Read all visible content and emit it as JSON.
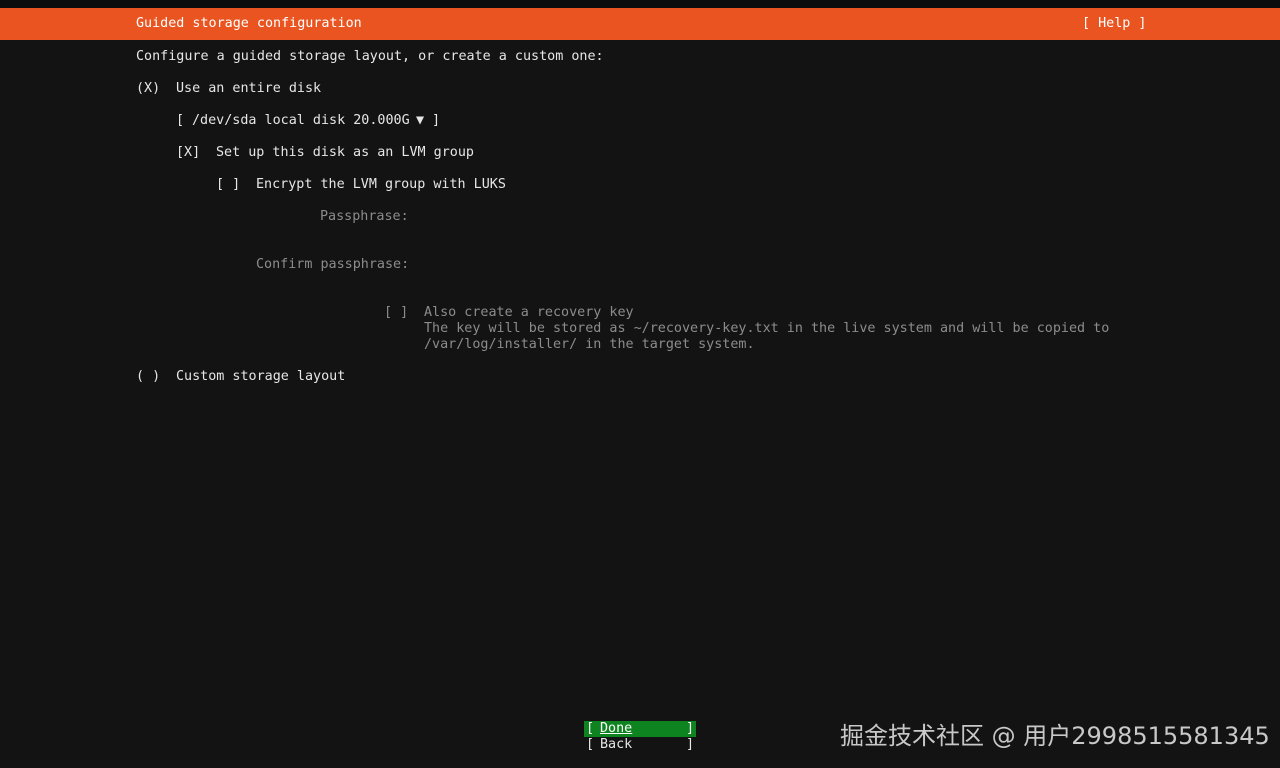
{
  "header": {
    "title": "Guided storage configuration",
    "help": "[ Help ]"
  },
  "intro": "Configure a guided storage layout, or create a custom one:",
  "option_entire_disk": {
    "marker": "(X)",
    "label": "Use an entire disk"
  },
  "disk_select": {
    "open_bracket": "[",
    "value": "/dev/sda local disk 20.000G",
    "arrow": "▼",
    "close_bracket": "]"
  },
  "lvm": {
    "marker": "[X]",
    "label": "Set up this disk as an LVM group"
  },
  "luks": {
    "marker": "[ ]",
    "label": "Encrypt the LVM group with LUKS"
  },
  "passphrase": {
    "label": "Passphrase:",
    "value": ""
  },
  "confirm_passphrase": {
    "label": "Confirm passphrase:",
    "value": ""
  },
  "recovery": {
    "marker": "[ ]",
    "label": "Also create a recovery key",
    "desc_line1": "The key will be stored as ~/recovery-key.txt in the live system and will be copied to",
    "desc_line2": "/var/log/installer/ in the target system."
  },
  "option_custom": {
    "marker": "( )",
    "label": "Custom storage layout"
  },
  "buttons": {
    "done": {
      "open": "[",
      "label": "Done",
      "close": "]"
    },
    "back": {
      "open": "[",
      "label": "Back",
      "close": "]"
    }
  },
  "watermark": "掘金技术社区 @ 用户2998515581345",
  "colors": {
    "header_bg": "#e95420",
    "background": "#131313",
    "focus_button_bg": "#0e8420",
    "dim_text": "#8c8c8c"
  }
}
